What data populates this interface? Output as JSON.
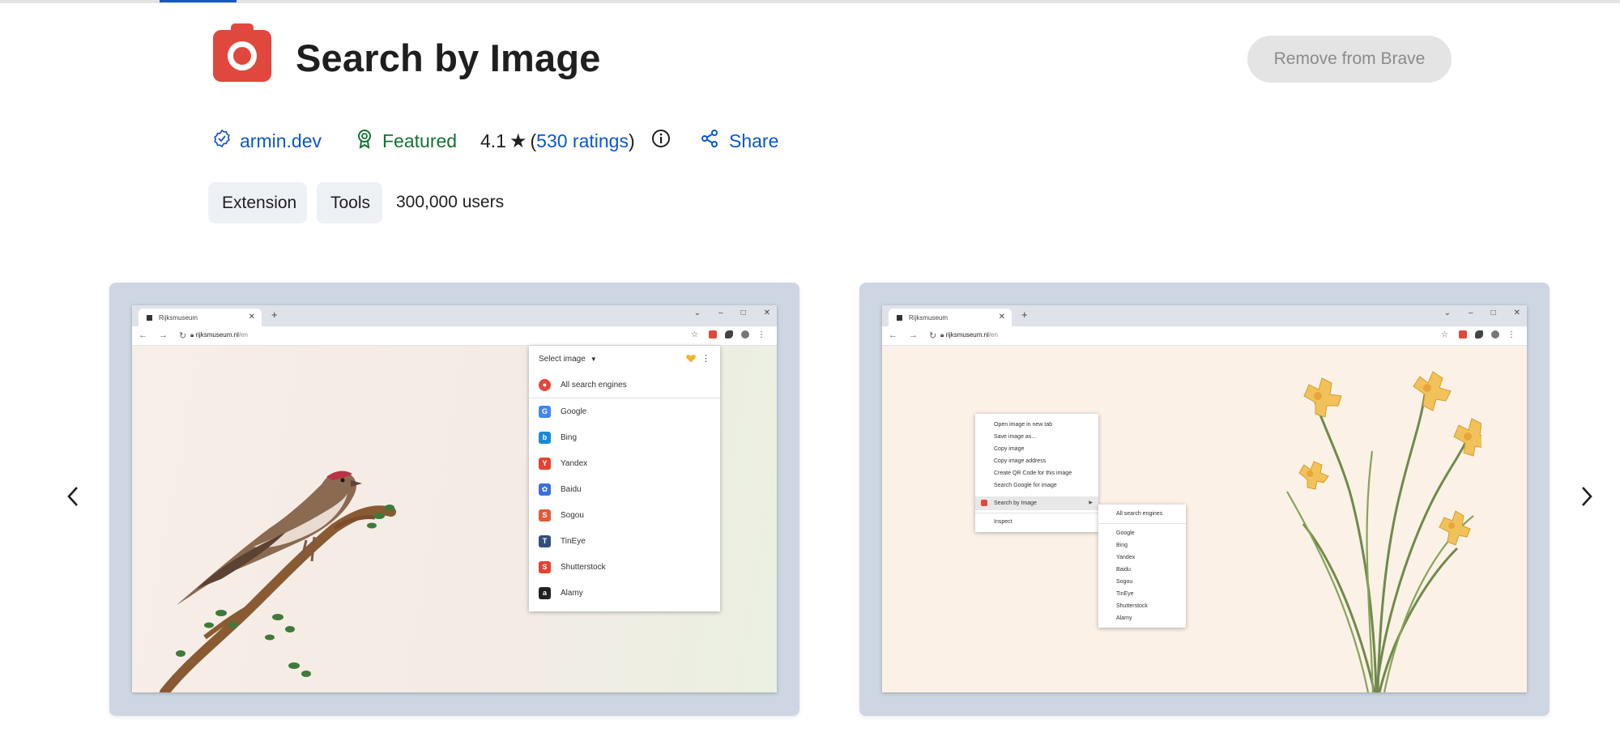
{
  "header": {
    "title": "Search by Image",
    "remove_label": "Remove from Brave",
    "icon": "camera-icon",
    "brand_color": "#e1483d"
  },
  "meta": {
    "author": "armin.dev",
    "featured_label": "Featured",
    "rating": "4.1",
    "ratings_open": "(",
    "ratings_link": "530 ratings",
    "ratings_close": ")",
    "share_label": "Share"
  },
  "chips": {
    "extension": "Extension",
    "tools": "Tools"
  },
  "users": "300,000 users",
  "screenshots": [
    {
      "tab_title": "Rijksmuseum",
      "url_domain": "rijksmuseum.nl",
      "url_path": "/en",
      "popup": {
        "select_label": "Select image",
        "all_engines": "All search engines",
        "engines": [
          {
            "name": "Google",
            "icon": "google-icon",
            "color": "#4285f4",
            "glyph": "G"
          },
          {
            "name": "Bing",
            "icon": "bing-icon",
            "color": "#1a8ad6",
            "glyph": "b"
          },
          {
            "name": "Yandex",
            "icon": "yandex-icon",
            "color": "#e8412f",
            "glyph": "Y"
          },
          {
            "name": "Baidu",
            "icon": "baidu-icon",
            "color": "#3b6ee0",
            "glyph": "✿"
          },
          {
            "name": "Sogou",
            "icon": "sogou-icon",
            "color": "#e25b3a",
            "glyph": "S"
          },
          {
            "name": "TinEye",
            "icon": "tineye-icon",
            "color": "#34507a",
            "glyph": "T"
          },
          {
            "name": "Shutterstock",
            "icon": "shutterstock-icon",
            "color": "#e8412f",
            "glyph": "S"
          },
          {
            "name": "Alamy",
            "icon": "alamy-icon",
            "color": "#222222",
            "glyph": "a"
          }
        ]
      }
    },
    {
      "tab_title": "Rijksmuseum",
      "url_domain": "rijksmuseum.nl",
      "url_path": "/en",
      "context_menu": {
        "items": [
          "Open image in new tab",
          "Save image as...",
          "Copy image",
          "Copy image address",
          "Create QR Code for this image",
          "Search Google for image"
        ],
        "active_item": "Search by Image",
        "inspect": "Inspect",
        "submenu_header": "All search engines",
        "submenu_items": [
          "Google",
          "Bing",
          "Yandex",
          "Baidu",
          "Sogou",
          "TinEye",
          "Shutterstock",
          "Alamy"
        ]
      }
    }
  ]
}
